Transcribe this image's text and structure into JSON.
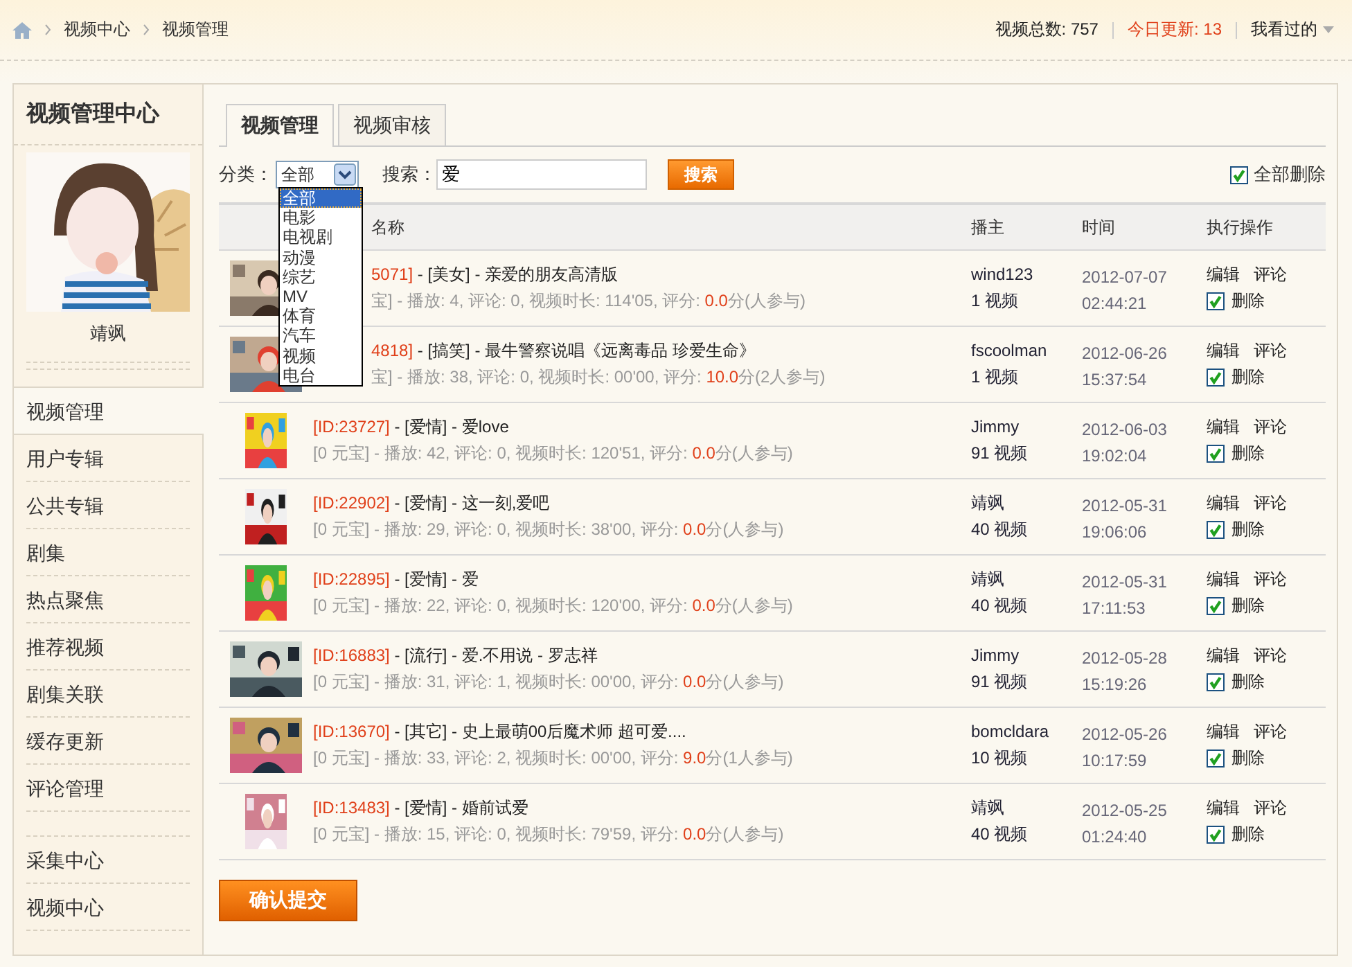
{
  "breadcrumb": [
    "视频中心",
    "视频管理"
  ],
  "stats": {
    "total": "视频总数: 757",
    "today": "今日更新: 13",
    "history": "我看过的"
  },
  "sidebar": {
    "title": "视频管理中心",
    "user": "靖飒",
    "sections": [
      {
        "items": [
          {
            "label": "视频管理",
            "selected": true
          },
          {
            "label": "用户专辑",
            "selected": false
          },
          {
            "label": "公共专辑",
            "selected": false
          },
          {
            "label": "剧集",
            "selected": false
          },
          {
            "label": "热点聚焦",
            "selected": false
          },
          {
            "label": "推荐视频",
            "selected": false
          },
          {
            "label": "剧集关联",
            "selected": false
          },
          {
            "label": "缓存更新",
            "selected": false
          },
          {
            "label": "评论管理",
            "selected": false
          }
        ]
      },
      {
        "items": [
          {
            "label": "采集中心",
            "selected": false
          },
          {
            "label": "视频中心",
            "selected": false
          }
        ]
      }
    ]
  },
  "tabs": [
    {
      "label": "视频管理",
      "selected": true
    },
    {
      "label": "视频审核",
      "selected": false
    }
  ],
  "filter": {
    "category_label": "分类：",
    "category_value": "全部",
    "search_label": "搜索：",
    "search_value": "爱",
    "search_button": "搜索",
    "delete_all": {
      "label": "全部删除",
      "checked": true
    }
  },
  "dropdown": {
    "expanded": true,
    "options": [
      {
        "label": "全部",
        "selected": true
      },
      {
        "label": "电影",
        "selected": false
      },
      {
        "label": "电视剧",
        "selected": false
      },
      {
        "label": "动漫",
        "selected": false
      },
      {
        "label": "综艺",
        "selected": false
      },
      {
        "label": "MV",
        "selected": false
      },
      {
        "label": "体育",
        "selected": false
      },
      {
        "label": "汽车",
        "selected": false
      },
      {
        "label": "视频",
        "selected": false
      },
      {
        "label": "电台",
        "selected": false
      }
    ]
  },
  "table": {
    "columns": [
      "名称",
      "播主",
      "时间",
      "执行操作"
    ],
    "rows": [
      {
        "under_menu": true,
        "id": "5071]",
        "title": " - [美女] - 亲爱的朋友高清版",
        "meta": "宝] - 播放: 4, 评论: 0, 视频时长: 114'05, 评分: ",
        "score": "0.0",
        "score_suffix": "分(人参与)",
        "host": "wind123",
        "host_count": "1 视频",
        "date": "2012-07-07",
        "time": "02:44:21",
        "edit": "编辑",
        "comment": "评论",
        "delete": "删除",
        "checked": true
      },
      {
        "under_menu": true,
        "id": "4818]",
        "title": " - [搞笑] - 最牛警察说唱《远离毒品 珍爱生命》",
        "meta": "宝] - 播放: 38, 评论: 0, 视频时长: 00'00, 评分: ",
        "score": "10.0",
        "score_suffix": "分(2人参与)",
        "host": "fscoolman",
        "host_count": "1 视频",
        "date": "2012-06-26",
        "time": "15:37:54",
        "edit": "编辑",
        "comment": "评论",
        "delete": "删除",
        "checked": true
      },
      {
        "under_menu": false,
        "id": "[ID:23727]",
        "title": " - [爱情] - 爱love",
        "meta": "[0 元宝] - 播放: 42, 评论: 0, 视频时长: 120'51, 评分: ",
        "score": "0.0",
        "score_suffix": "分(人参与)",
        "host": "Jimmy",
        "host_count": "91 视频",
        "date": "2012-06-03",
        "time": "19:02:04",
        "edit": "编辑",
        "comment": "评论",
        "delete": "删除",
        "checked": true
      },
      {
        "under_menu": false,
        "id": "[ID:22902]",
        "title": " - [爱情] - 这一刻,爱吧",
        "meta": "[0 元宝] - 播放: 29, 评论: 0, 视频时长: 38'00, 评分: ",
        "score": "0.0",
        "score_suffix": "分(人参与)",
        "host": "靖飒",
        "host_count": "40 视频",
        "date": "2012-05-31",
        "time": "19:06:06",
        "edit": "编辑",
        "comment": "评论",
        "delete": "删除",
        "checked": true
      },
      {
        "under_menu": false,
        "id": "[ID:22895]",
        "title": " - [爱情] - 爱",
        "meta": "[0 元宝] - 播放: 22, 评论: 0, 视频时长: 120'00, 评分: ",
        "score": "0.0",
        "score_suffix": "分(人参与)",
        "host": "靖飒",
        "host_count": "40 视频",
        "date": "2012-05-31",
        "time": "17:11:53",
        "edit": "编辑",
        "comment": "评论",
        "delete": "删除",
        "checked": true
      },
      {
        "under_menu": false,
        "id": "[ID:16883]",
        "title": " - [流行] - 爱.不用说 - 罗志祥",
        "meta": "[0 元宝] - 播放: 31, 评论: 1, 视频时长: 00'00, 评分: ",
        "score": "0.0",
        "score_suffix": "分(人参与)",
        "host": "Jimmy",
        "host_count": "91 视频",
        "date": "2012-05-28",
        "time": "15:19:26",
        "edit": "编辑",
        "comment": "评论",
        "delete": "删除",
        "checked": true
      },
      {
        "under_menu": false,
        "id": "[ID:13670]",
        "title": " - [其它] - 史上最萌00后魔术师 超可爱....",
        "meta": "[0 元宝] - 播放: 33, 评论: 2, 视频时长: 00'00, 评分: ",
        "score": "9.0",
        "score_suffix": "分(1人参与)",
        "host": "bomcldara",
        "host_count": "10 视频",
        "date": "2012-05-26",
        "time": "10:17:59",
        "edit": "编辑",
        "comment": "评论",
        "delete": "删除",
        "checked": true
      },
      {
        "under_menu": false,
        "id": "[ID:13483]",
        "title": " - [爱情] - 婚前试爱",
        "meta": "[0 元宝] - 播放: 15, 评论: 0, 视频时长: 79'59, 评分: ",
        "score": "0.0",
        "score_suffix": "分(人参与)",
        "host": "靖飒",
        "host_count": "40 视频",
        "date": "2012-05-25",
        "time": "01:24:40",
        "edit": "编辑",
        "comment": "评论",
        "delete": "删除",
        "checked": true
      }
    ]
  },
  "submit": "确认提交"
}
